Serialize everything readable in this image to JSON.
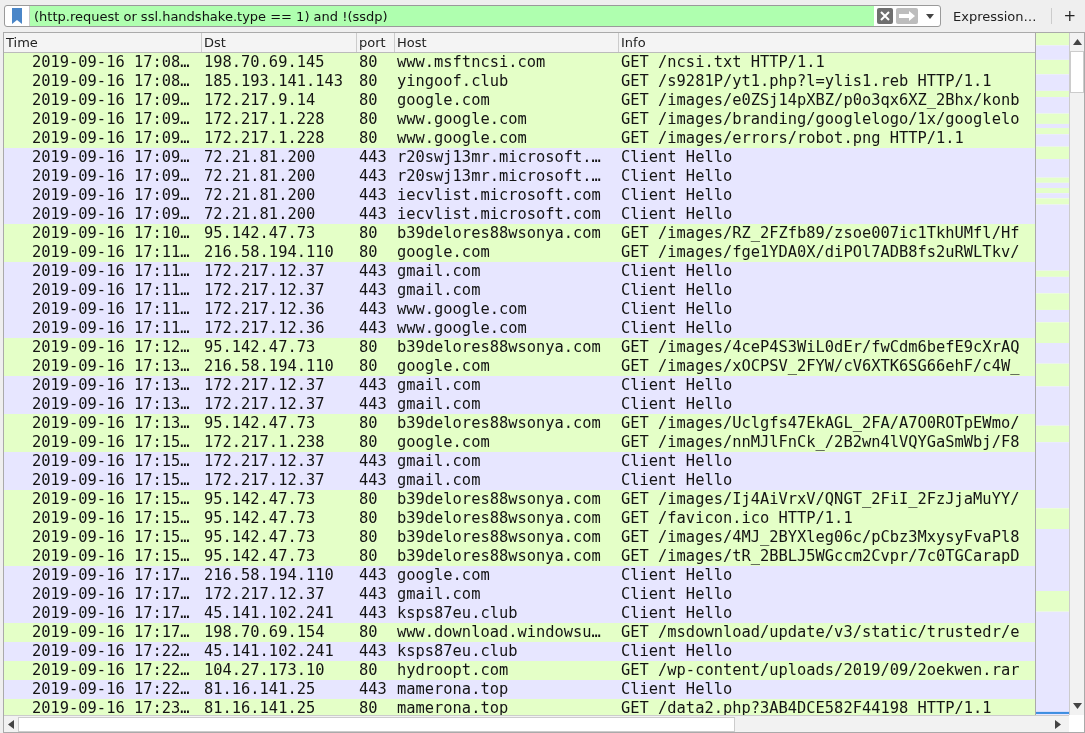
{
  "filter": {
    "value": "(http.request or ssl.handshake.type == 1) and !(ssdp)",
    "valid": true
  },
  "expression_button": "Expression…",
  "add_button": "+",
  "columns": [
    "Time",
    "Dst",
    "port",
    "Host",
    "Info"
  ],
  "rows": [
    {
      "kind": "http",
      "time": "2019-09-16 17:08…",
      "dst": "198.70.69.145",
      "port": "80",
      "host": "www.msftncsi.com",
      "info": "GET /ncsi.txt HTTP/1.1"
    },
    {
      "kind": "http",
      "time": "2019-09-16 17:08…",
      "dst": "185.193.141.143",
      "port": "80",
      "host": "yingoof.club",
      "info": "GET /s9281P/yt1.php?l=ylis1.reb HTTP/1.1"
    },
    {
      "kind": "http",
      "time": "2019-09-16 17:09…",
      "dst": "172.217.9.14",
      "port": "80",
      "host": "google.com",
      "info": "GET /images/e0ZSj14pXBZ/p0o3qx6XZ_2Bhx/konb"
    },
    {
      "kind": "http",
      "time": "2019-09-16 17:09…",
      "dst": "172.217.1.228",
      "port": "80",
      "host": "www.google.com",
      "info": "GET /images/branding/googlelogo/1x/googlelo"
    },
    {
      "kind": "http",
      "time": "2019-09-16 17:09…",
      "dst": "172.217.1.228",
      "port": "80",
      "host": "www.google.com",
      "info": "GET /images/errors/robot.png HTTP/1.1"
    },
    {
      "kind": "tls",
      "time": "2019-09-16 17:09…",
      "dst": "72.21.81.200",
      "port": "443",
      "host": "r20swj13mr.microsoft.…",
      "info": "Client Hello"
    },
    {
      "kind": "tls",
      "time": "2019-09-16 17:09…",
      "dst": "72.21.81.200",
      "port": "443",
      "host": "r20swj13mr.microsoft.…",
      "info": "Client Hello"
    },
    {
      "kind": "tls",
      "time": "2019-09-16 17:09…",
      "dst": "72.21.81.200",
      "port": "443",
      "host": "iecvlist.microsoft.com",
      "info": "Client Hello"
    },
    {
      "kind": "tls",
      "time": "2019-09-16 17:09…",
      "dst": "72.21.81.200",
      "port": "443",
      "host": "iecvlist.microsoft.com",
      "info": "Client Hello"
    },
    {
      "kind": "http",
      "time": "2019-09-16 17:10…",
      "dst": "95.142.47.73",
      "port": "80",
      "host": "b39delores88wsonya.com",
      "info": "GET /images/RZ_2FZfb89/zsoe007ic1TkhUMfl/Hf"
    },
    {
      "kind": "http",
      "time": "2019-09-16 17:11…",
      "dst": "216.58.194.110",
      "port": "80",
      "host": "google.com",
      "info": "GET /images/fge1YDA0X/diPOl7ADB8fs2uRWLTkv/"
    },
    {
      "kind": "tls",
      "time": "2019-09-16 17:11…",
      "dst": "172.217.12.37",
      "port": "443",
      "host": "gmail.com",
      "info": "Client Hello"
    },
    {
      "kind": "tls",
      "time": "2019-09-16 17:11…",
      "dst": "172.217.12.37",
      "port": "443",
      "host": "gmail.com",
      "info": "Client Hello"
    },
    {
      "kind": "tls",
      "time": "2019-09-16 17:11…",
      "dst": "172.217.12.36",
      "port": "443",
      "host": "www.google.com",
      "info": "Client Hello"
    },
    {
      "kind": "tls",
      "time": "2019-09-16 17:11…",
      "dst": "172.217.12.36",
      "port": "443",
      "host": "www.google.com",
      "info": "Client Hello"
    },
    {
      "kind": "http",
      "time": "2019-09-16 17:12…",
      "dst": "95.142.47.73",
      "port": "80",
      "host": "b39delores88wsonya.com",
      "info": "GET /images/4ceP4S3WiL0dEr/fwCdm6befE9cXrAQ"
    },
    {
      "kind": "http",
      "time": "2019-09-16 17:13…",
      "dst": "216.58.194.110",
      "port": "80",
      "host": "google.com",
      "info": "GET /images/xOCPSV_2FYW/cV6XTK6SG66ehF/c4W_"
    },
    {
      "kind": "tls",
      "time": "2019-09-16 17:13…",
      "dst": "172.217.12.37",
      "port": "443",
      "host": "gmail.com",
      "info": "Client Hello"
    },
    {
      "kind": "tls",
      "time": "2019-09-16 17:13…",
      "dst": "172.217.12.37",
      "port": "443",
      "host": "gmail.com",
      "info": "Client Hello"
    },
    {
      "kind": "http",
      "time": "2019-09-16 17:13…",
      "dst": "95.142.47.73",
      "port": "80",
      "host": "b39delores88wsonya.com",
      "info": "GET /images/Uclgfs47EkAGL_2FA/A7O0ROTpEWmo/"
    },
    {
      "kind": "http",
      "time": "2019-09-16 17:15…",
      "dst": "172.217.1.238",
      "port": "80",
      "host": "google.com",
      "info": "GET /images/nnMJlFnCk_/2B2wn4lVQYGaSmWbj/F8"
    },
    {
      "kind": "tls",
      "time": "2019-09-16 17:15…",
      "dst": "172.217.12.37",
      "port": "443",
      "host": "gmail.com",
      "info": "Client Hello"
    },
    {
      "kind": "tls",
      "time": "2019-09-16 17:15…",
      "dst": "172.217.12.37",
      "port": "443",
      "host": "gmail.com",
      "info": "Client Hello"
    },
    {
      "kind": "http",
      "time": "2019-09-16 17:15…",
      "dst": "95.142.47.73",
      "port": "80",
      "host": "b39delores88wsonya.com",
      "info": "GET /images/Ij4AiVrxV/QNGT_2FiI_2FzJjaMuYY/"
    },
    {
      "kind": "http",
      "time": "2019-09-16 17:15…",
      "dst": "95.142.47.73",
      "port": "80",
      "host": "b39delores88wsonya.com",
      "info": "GET /favicon.ico HTTP/1.1"
    },
    {
      "kind": "http",
      "time": "2019-09-16 17:15…",
      "dst": "95.142.47.73",
      "port": "80",
      "host": "b39delores88wsonya.com",
      "info": "GET /images/4MJ_2BYXleg06c/pCbz3MxysyFvaPl8"
    },
    {
      "kind": "http",
      "time": "2019-09-16 17:15…",
      "dst": "95.142.47.73",
      "port": "80",
      "host": "b39delores88wsonya.com",
      "info": "GET /images/tR_2BBLJ5WGccm2Cvpr/7c0TGCarapD"
    },
    {
      "kind": "tls",
      "time": "2019-09-16 17:17…",
      "dst": "216.58.194.110",
      "port": "443",
      "host": "google.com",
      "info": "Client Hello"
    },
    {
      "kind": "tls",
      "time": "2019-09-16 17:17…",
      "dst": "172.217.12.37",
      "port": "443",
      "host": "gmail.com",
      "info": "Client Hello"
    },
    {
      "kind": "tls",
      "time": "2019-09-16 17:17…",
      "dst": "45.141.102.241",
      "port": "443",
      "host": "ksps87eu.club",
      "info": "Client Hello"
    },
    {
      "kind": "http",
      "time": "2019-09-16 17:17…",
      "dst": "198.70.69.154",
      "port": "80",
      "host": "www.download.windowsu…",
      "info": "GET /msdownload/update/v3/static/trustedr/e"
    },
    {
      "kind": "tls",
      "time": "2019-09-16 17:22…",
      "dst": "45.141.102.241",
      "port": "443",
      "host": "ksps87eu.club",
      "info": "Client Hello"
    },
    {
      "kind": "http",
      "time": "2019-09-16 17:22…",
      "dst": "104.27.173.10",
      "port": "80",
      "host": "hydroopt.com",
      "info": "GET /wp-content/uploads/2019/09/2oekwen.rar"
    },
    {
      "kind": "tls",
      "time": "2019-09-16 17:22…",
      "dst": "81.16.141.25",
      "port": "443",
      "host": "mamerona.top",
      "info": "Client Hello"
    },
    {
      "kind": "http",
      "time": "2019-09-16 17:23…",
      "dst": "81.16.141.25",
      "port": "80",
      "host": "mamerona.top",
      "info": "GET /data2.php?3AB4DCE582F44198 HTTP/1.1"
    }
  ]
}
